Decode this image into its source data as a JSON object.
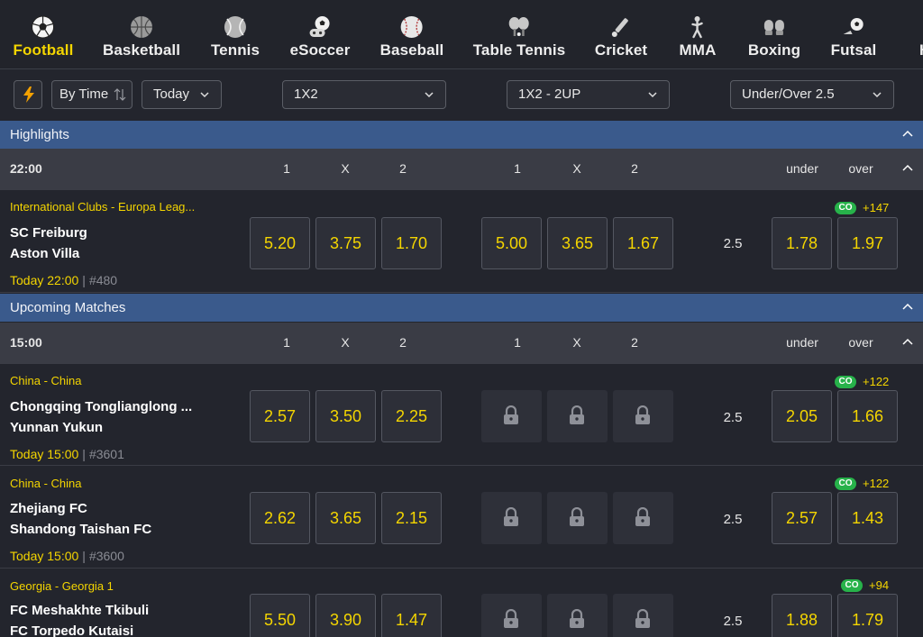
{
  "sports": [
    {
      "label": "Football",
      "icon": "football-icon",
      "active": true
    },
    {
      "label": "Basketball",
      "icon": "basketball-icon"
    },
    {
      "label": "Tennis",
      "icon": "tennis-ball-icon"
    },
    {
      "label": "eSoccer",
      "icon": "esoccer-icon"
    },
    {
      "label": "Baseball",
      "icon": "baseball-icon"
    },
    {
      "label": "Table Tennis",
      "icon": "table-tennis-icon"
    },
    {
      "label": "Cricket",
      "icon": "cricket-icon"
    },
    {
      "label": "MMA",
      "icon": "mma-icon"
    },
    {
      "label": "Boxing",
      "icon": "boxing-gloves-icon"
    },
    {
      "label": "Futsal",
      "icon": "futsal-icon"
    },
    {
      "label": "Ha",
      "icon": "handball-icon"
    }
  ],
  "filters": {
    "sort": "By Time",
    "day": "Today",
    "market1": "1X2",
    "market2": "1X2 - 2UP",
    "market3": "Under/Over 2.5"
  },
  "columns": {
    "one": "1",
    "x": "X",
    "two": "2",
    "under": "under",
    "over": "over"
  },
  "highlights": {
    "title": "Highlights",
    "time": "22:00",
    "matches": [
      {
        "league": "International Clubs - Europa Leag...",
        "home": "SC Freiburg",
        "away": "Aston Villa",
        "when": "Today 22:00",
        "id": "#480",
        "odds_1x2": [
          "5.20",
          "3.75",
          "1.70"
        ],
        "odds_2up": [
          "5.00",
          "3.65",
          "1.67"
        ],
        "locked_2up": false,
        "line": "2.5",
        "under": "1.78",
        "over": "1.97",
        "co": "CO",
        "more": "+147"
      }
    ]
  },
  "upcoming": {
    "title": "Upcoming Matches",
    "time": "15:00",
    "matches": [
      {
        "league": "China - China",
        "home": "Chongqing Tonglianglong ...",
        "away": "Yunnan Yukun",
        "when": "Today 15:00",
        "id": "#3601",
        "odds_1x2": [
          "2.57",
          "3.50",
          "2.25"
        ],
        "locked_2up": true,
        "line": "2.5",
        "under": "2.05",
        "over": "1.66",
        "co": "CO",
        "more": "+122"
      },
      {
        "league": "China - China",
        "home": "Zhejiang FC",
        "away": "Shandong Taishan FC",
        "when": "Today 15:00",
        "id": "#3600",
        "odds_1x2": [
          "2.62",
          "3.65",
          "2.15"
        ],
        "locked_2up": true,
        "line": "2.5",
        "under": "2.57",
        "over": "1.43",
        "co": "CO",
        "more": "+122"
      },
      {
        "league": "Georgia - Georgia 1",
        "home": "FC Meshakhte Tkibuli",
        "away": "FC Torpedo Kutaisi",
        "when": "",
        "id": "",
        "odds_1x2": [
          "5.50",
          "3.90",
          "1.47"
        ],
        "locked_2up": true,
        "line": "2.5",
        "under": "1.88",
        "over": "1.79",
        "co": "CO",
        "more": "+94"
      }
    ]
  },
  "colors": {
    "accent": "#f4d500",
    "section": "#3a5a8c",
    "co_badge": "#27b24a"
  }
}
